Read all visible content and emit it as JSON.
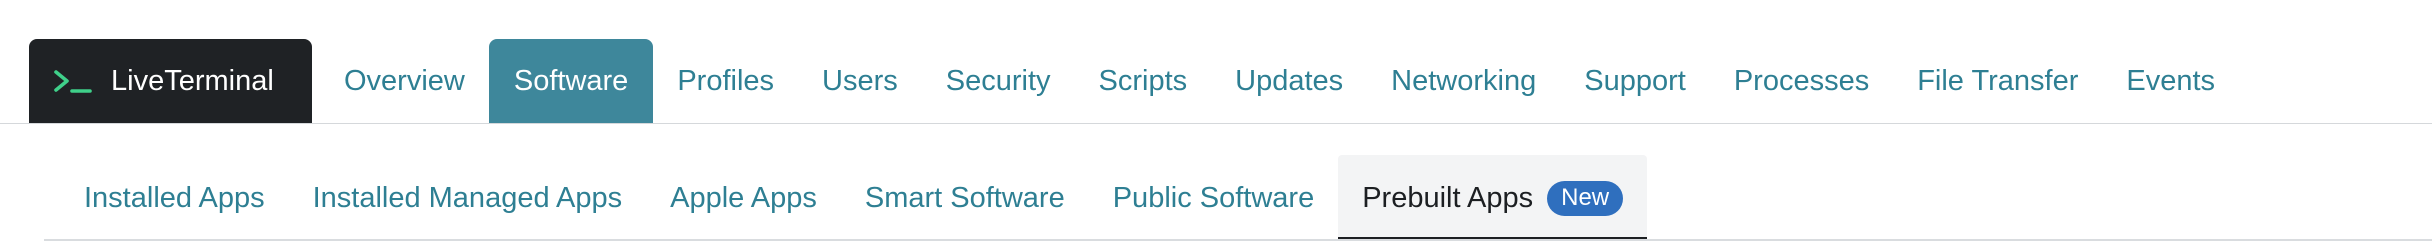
{
  "primary_nav": {
    "live_terminal": {
      "label": "LiveTerminal",
      "icon": "terminal-prompt-icon",
      "icon_color": "#3fd08a"
    },
    "tabs": [
      {
        "label": "Overview",
        "active": false
      },
      {
        "label": "Software",
        "active": true
      },
      {
        "label": "Profiles",
        "active": false
      },
      {
        "label": "Users",
        "active": false
      },
      {
        "label": "Security",
        "active": false
      },
      {
        "label": "Scripts",
        "active": false
      },
      {
        "label": "Updates",
        "active": false
      },
      {
        "label": "Networking",
        "active": false
      },
      {
        "label": "Support",
        "active": false
      },
      {
        "label": "Processes",
        "active": false
      },
      {
        "label": "File Transfer",
        "active": false
      },
      {
        "label": "Events",
        "active": false
      }
    ]
  },
  "secondary_nav": {
    "tabs": [
      {
        "label": "Installed Apps",
        "active": false
      },
      {
        "label": "Installed Managed Apps",
        "active": false
      },
      {
        "label": "Apple Apps",
        "active": false
      },
      {
        "label": "Smart Software",
        "active": false
      },
      {
        "label": "Public Software",
        "active": false
      },
      {
        "label": "Prebuilt Apps",
        "active": true,
        "badge": "New"
      }
    ]
  },
  "colors": {
    "accent": "#3e879b",
    "link": "#2e7f93",
    "dark": "#1f2225",
    "badge": "#2f6fbe"
  }
}
